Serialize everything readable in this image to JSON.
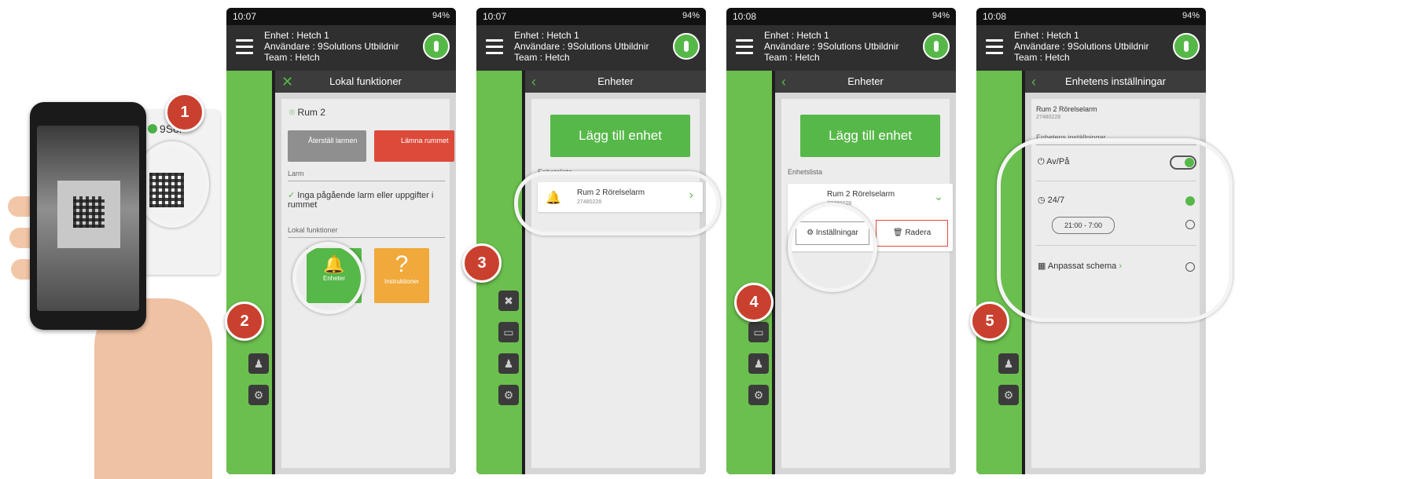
{
  "step_labels": [
    "1",
    "2",
    "3",
    "4",
    "5"
  ],
  "status": {
    "s1_time": "10:07",
    "s2_time": "10:07",
    "s3_time": "10:08",
    "s4_time": "10:08",
    "battery": "94%"
  },
  "header": {
    "device": "Enhet : Hetch 1",
    "user": "Användare : 9Solutions Utbildnir",
    "team": "Team : Hetch"
  },
  "card_brand": "9Sol",
  "screen1": {
    "title": "Lokal funktioner",
    "room": "Rum 2",
    "reset_label": "Återställ larmen",
    "leave_label": "Lämna rummet",
    "alarms_section": "Larm",
    "no_alarms": "Inga pågående larm eller uppgifter i rummet",
    "local_section": "Lokal funktioner",
    "devices_label": "Enheter",
    "help_label": "Instruktioner",
    "help_symbol": "?"
  },
  "screen2": {
    "title": "Enheter",
    "add_label": "Lägg till enhet",
    "list_label": "Enhetslista",
    "device_name": "Rum 2 Rörelselarm",
    "device_id": "27480228"
  },
  "screen3": {
    "title": "Enheter",
    "add_label": "Lägg till enhet",
    "list_label": "Enhetslista",
    "device_name": "Rum 2 Rörelselarm",
    "device_id": "27480228",
    "settings_label": "Inställningar",
    "delete_label": "Radera"
  },
  "screen4": {
    "title": "Enhetens inställningar",
    "device_name": "Rum 2 Rörelselarm",
    "device_id": "27480228",
    "section": "Enhetens inställningar",
    "onoff_label": "Av/På",
    "always_label": "24/7",
    "time_range": "21:00 - 7:00",
    "custom_label": "Anpassat schema"
  },
  "colors": {
    "brand_green": "#56b848",
    "step_red": "#c9402e",
    "alert_red": "#dd4a3a",
    "help_orange": "#f0a93a"
  }
}
